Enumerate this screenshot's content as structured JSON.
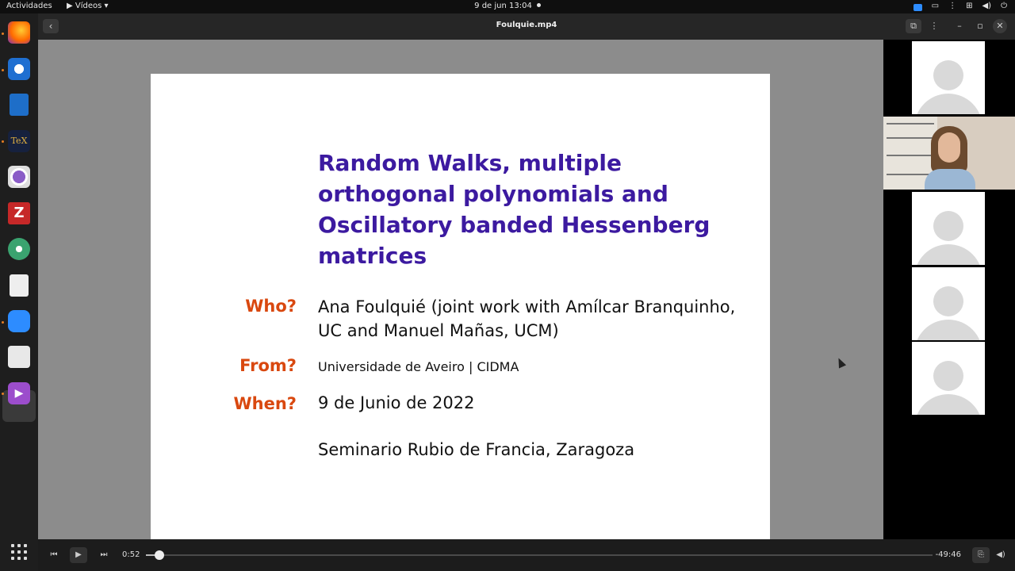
{
  "topbar": {
    "activities": "Actividades",
    "app_menu": "▶ Vídeos ▾",
    "datetime": "9 de jun  13:04",
    "tray_icons": [
      "zoom-icon",
      "screen-icon",
      "more-icon",
      "network-icon",
      "volume-icon",
      "power-icon"
    ]
  },
  "dock": {
    "items": [
      "firefox",
      "thunderbird",
      "libreoffice-writer",
      "texmaker",
      "screen-recorder",
      "filezilla",
      "atom",
      "document-viewer",
      "zoom",
      "files",
      "videos"
    ]
  },
  "window": {
    "title": "Foulquie.mp4",
    "back_label": "‹",
    "minimize_label": "–",
    "restore_label": "▫",
    "close_label": "✕",
    "menu_label": "⋮",
    "pip_label": "⧉"
  },
  "slide": {
    "title": "Random Walks, multiple orthogonal polynomials and Oscillatory banded Hessenberg matrices",
    "who_label": "Who?",
    "who_value": "Ana Foulquié (joint work with Amílcar Branquinho, UC and Manuel Mañas, UCM)",
    "from_label": "From?",
    "from_value": "Universidade de Aveiro | CIDMA",
    "when_label": "When?",
    "when_value": "9 de Junio de 2022",
    "venue": "Seminario Rubio de Francia, Zaragoza"
  },
  "player": {
    "elapsed": "0:52",
    "remaining": "-49:46",
    "progress": 0.017
  }
}
